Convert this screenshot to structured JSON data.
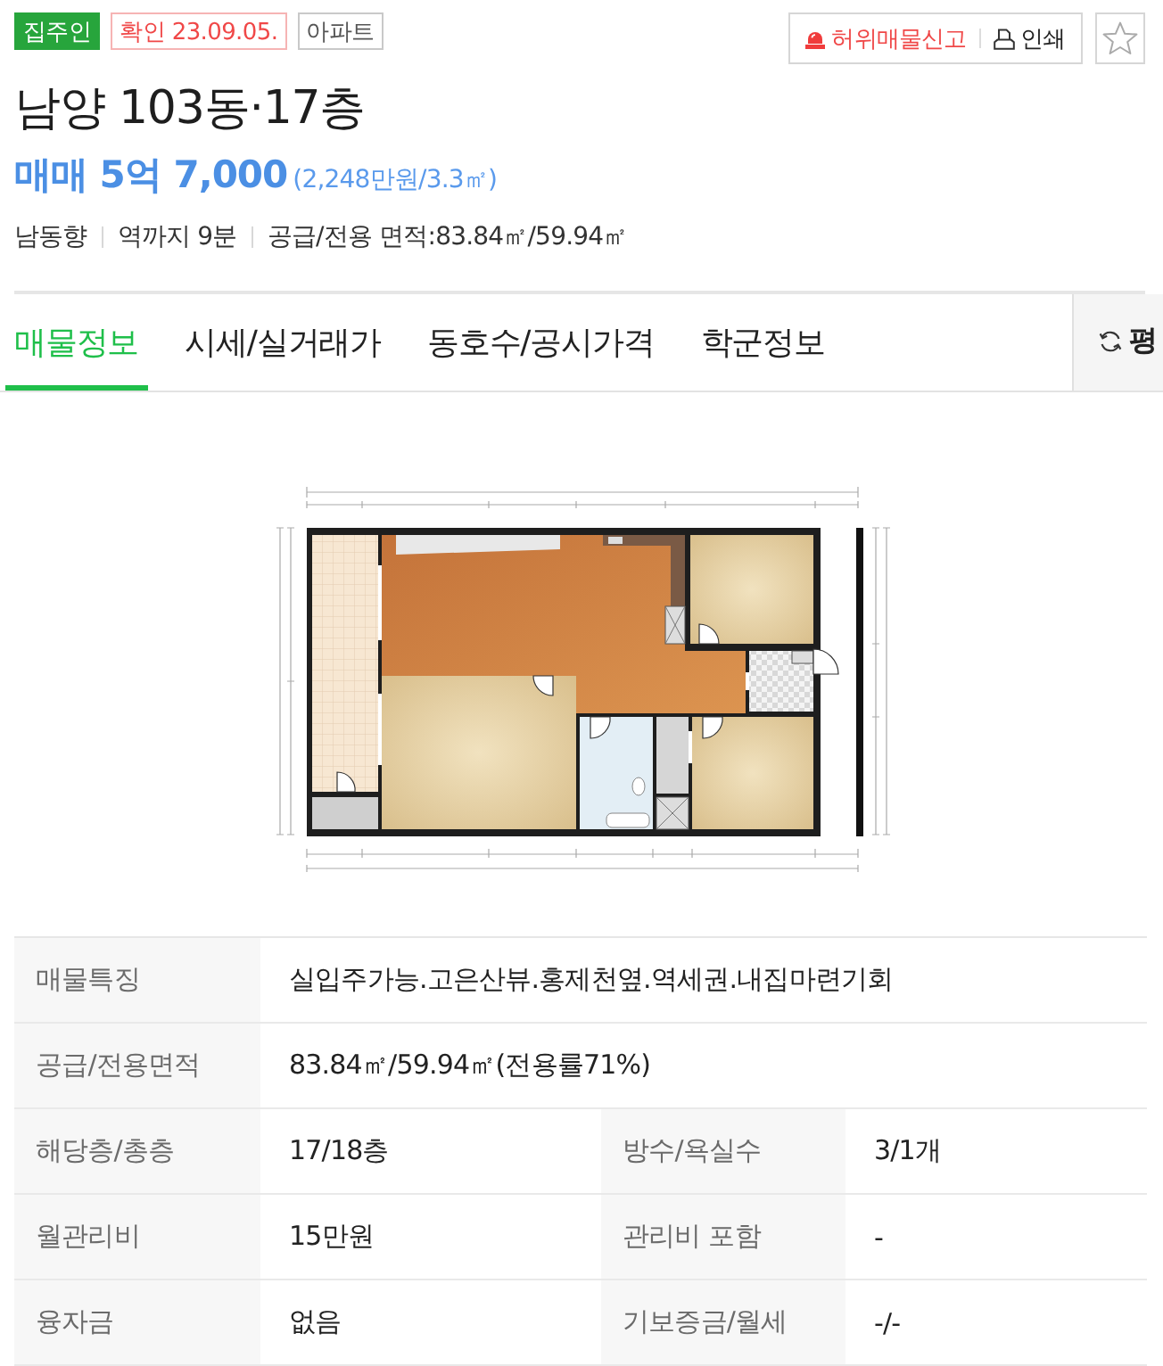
{
  "badges": [
    {
      "kind": "owner",
      "label": "집주인"
    },
    {
      "kind": "verified",
      "label": "확인 23.09.05."
    },
    {
      "kind": "type",
      "label": "아파트"
    }
  ],
  "actions": {
    "report": "허위매물신고",
    "print": "인쇄",
    "favorite": false
  },
  "title": "남양 103동·17층",
  "price": {
    "main": "매매 5억 7,000",
    "per_pyeong": "(2,248만원/3.3㎡)"
  },
  "summary": [
    "남동향",
    "역까지 9분",
    "공급/전용 면적:83.84㎡/59.94㎡"
  ],
  "tabs": [
    {
      "label": "매물정보",
      "selected": true
    },
    {
      "label": "시세/실거래가",
      "selected": false
    },
    {
      "label": "동호수/공시가격",
      "selected": false
    },
    {
      "label": "학군정보",
      "selected": false
    }
  ],
  "unit_toggle": {
    "label": "평"
  },
  "details": [
    {
      "cells": [
        {
          "label": "매물특징",
          "value": "실입주가능.고은산뷰.홍제천옆.역세권.내집마련기회"
        }
      ]
    },
    {
      "cells": [
        {
          "label": "공급/전용면적",
          "value": "83.84㎡/59.94㎡(전용률71%)"
        }
      ]
    },
    {
      "cells": [
        {
          "label": "해당층/총층",
          "value": "17/18층"
        },
        {
          "label": "방수/욕실수",
          "value": "3/1개"
        }
      ]
    },
    {
      "cells": [
        {
          "label": "월관리비",
          "value": "15만원"
        },
        {
          "label": "관리비 포함",
          "value": "-"
        }
      ]
    },
    {
      "cells": [
        {
          "label": "융자금",
          "value": "없음"
        },
        {
          "label": "기보증금/월세",
          "value": "-/-"
        }
      ]
    }
  ]
}
